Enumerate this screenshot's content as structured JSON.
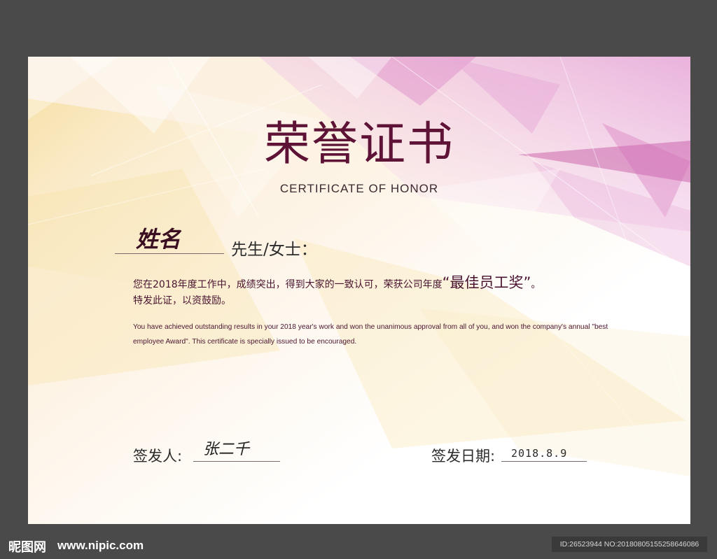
{
  "certificate": {
    "title_cn": "荣誉证书",
    "title_en": "CERTIFICATE OF HONOR",
    "name_signature": "姓名",
    "salutation": "先生/女士：",
    "body_cn_1": "您在2018年度工作中，成绩突出，得到大家的一致认可，荣获公司年度",
    "award_name": "“最佳员工奖”",
    "body_cn_1_end": "。",
    "body_cn_2": "特发此证，以资鼓励。",
    "body_en": "You have achieved outstanding results in your 2018 year's work and won the unanimous approval from all of you, and won the company's annual \"best employee Award\". This certificate is specially issued to be encouraged.",
    "issuer_label": "签发人:",
    "issuer_signature": "张二千",
    "date_label": "签发日期:",
    "date_value": "2018.8.9"
  },
  "footer": {
    "logo_text": "昵图网",
    "site_url": "www.nipic.com",
    "image_id": "ID:26523944 NO:20180805155258646086"
  },
  "colors": {
    "title": "#5e1236",
    "text_dark": "#2b2b2b",
    "text_body": "#4a1430",
    "frame": "#4a4a4a",
    "accent_pink": "#d070b8",
    "accent_yellow": "#f3d27a"
  }
}
